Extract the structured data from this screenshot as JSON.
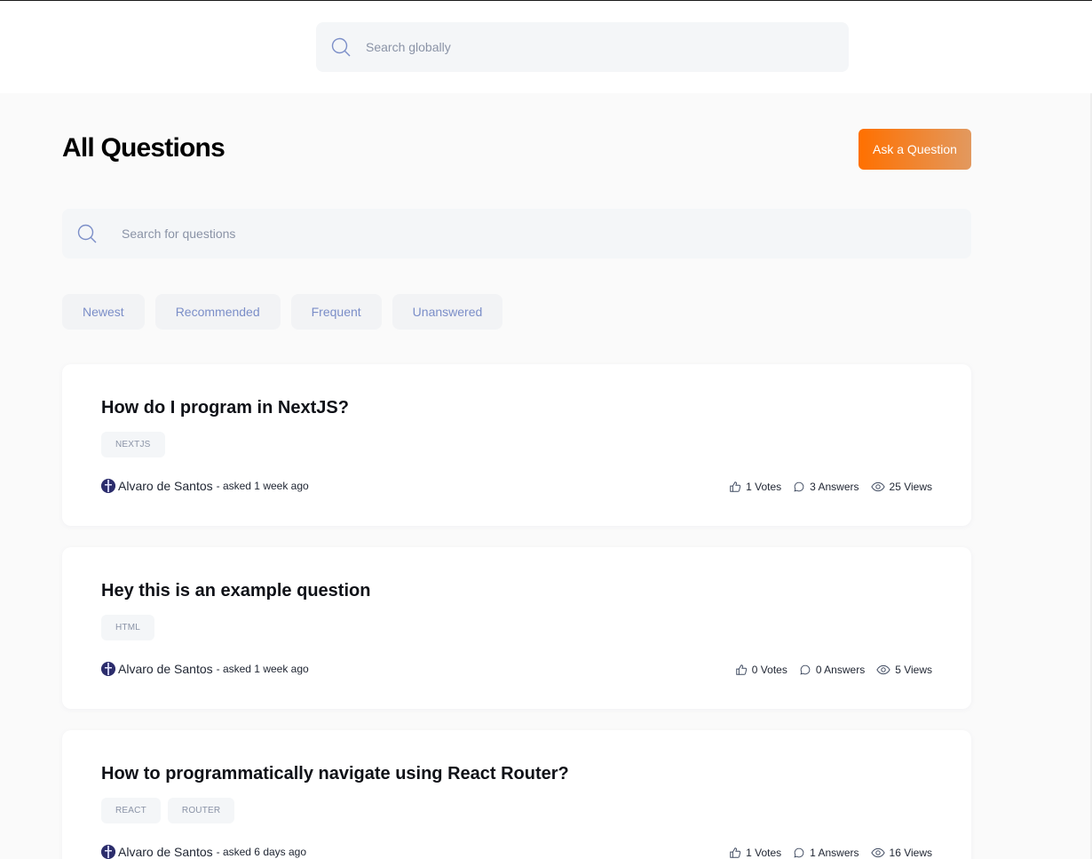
{
  "header": {
    "search_placeholder": "Search globally"
  },
  "main": {
    "title": "All Questions",
    "ask_button": "Ask a Question",
    "search_placeholder": "Search for questions",
    "filters": [
      "Newest",
      "Recommended",
      "Frequent",
      "Unanswered"
    ]
  },
  "questions": [
    {
      "title": "How do I program in NextJS?",
      "tags": [
        "NEXTJS"
      ],
      "author": "Alvaro de Santos",
      "asked": "- asked 1 week ago",
      "votes": "1 Votes",
      "answers": "3 Answers",
      "views": "25 Views"
    },
    {
      "title": "Hey this is an example question",
      "tags": [
        "HTML"
      ],
      "author": "Alvaro de Santos",
      "asked": "- asked 1 week ago",
      "votes": "0 Votes",
      "answers": "0 Answers",
      "views": "5 Views"
    },
    {
      "title": "How to programmatically navigate using React Router?",
      "tags": [
        "REACT",
        "ROUTER"
      ],
      "author": "Alvaro de Santos",
      "asked": "- asked 6 days ago",
      "votes": "1 Votes",
      "answers": "1 Answers",
      "views": "16 Views"
    }
  ],
  "icons": {
    "search": "search-icon",
    "votes": "thumbs-up-icon",
    "answers": "message-icon",
    "views": "eye-icon",
    "avatar": "avatar"
  },
  "colors": {
    "accent_start": "#ff7000",
    "accent_end": "#e2995f",
    "filter_text": "#7b8ec8",
    "background": "#fafafa"
  }
}
